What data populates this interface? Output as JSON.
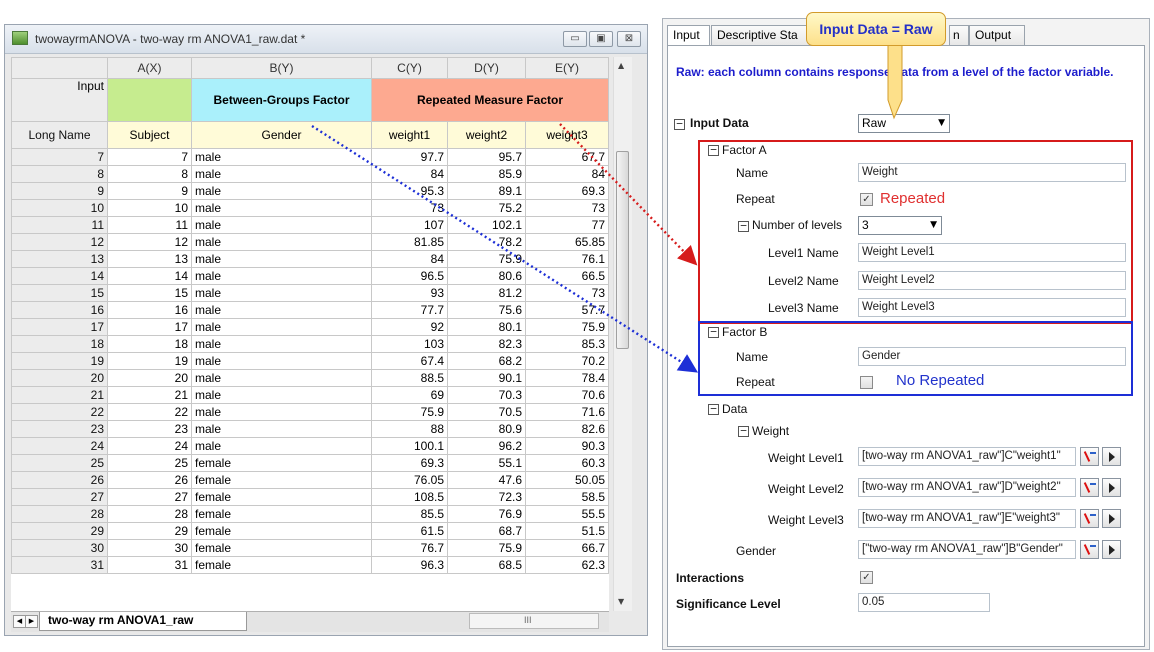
{
  "worksheet": {
    "title": "twowayrmANOVA - two-way rm ANOVA1_raw.dat *",
    "window_buttons": [
      "▭",
      "▣",
      "⊠"
    ],
    "col_headers": [
      "",
      "A(X)",
      "B(Y)",
      "C(Y)",
      "D(Y)",
      "E(Y)"
    ],
    "input_row": {
      "label": "Input",
      "between": "Between-Groups Factor",
      "repeated": "Repeated Measure Factor"
    },
    "longname_row": {
      "label": "Long Name",
      "cells": [
        "Subject",
        "Gender",
        "weight1",
        "weight2",
        "weight3"
      ]
    },
    "rows": [
      [
        "7",
        "7",
        "male",
        "97.7",
        "95.7",
        "67.7"
      ],
      [
        "8",
        "8",
        "male",
        "84",
        "85.9",
        "84"
      ],
      [
        "9",
        "9",
        "male",
        "95.3",
        "89.1",
        "69.3"
      ],
      [
        "10",
        "10",
        "male",
        "73",
        "75.2",
        "73"
      ],
      [
        "11",
        "11",
        "male",
        "107",
        "102.1",
        "77"
      ],
      [
        "12",
        "12",
        "male",
        "81.85",
        "78.2",
        "65.85"
      ],
      [
        "13",
        "13",
        "male",
        "84",
        "75.9",
        "76.1"
      ],
      [
        "14",
        "14",
        "male",
        "96.5",
        "80.6",
        "66.5"
      ],
      [
        "15",
        "15",
        "male",
        "93",
        "81.2",
        "73"
      ],
      [
        "16",
        "16",
        "male",
        "77.7",
        "75.6",
        "57.7"
      ],
      [
        "17",
        "17",
        "male",
        "92",
        "80.1",
        "75.9"
      ],
      [
        "18",
        "18",
        "male",
        "103",
        "82.3",
        "85.3"
      ],
      [
        "19",
        "19",
        "male",
        "67.4",
        "68.2",
        "70.2"
      ],
      [
        "20",
        "20",
        "male",
        "88.5",
        "90.1",
        "78.4"
      ],
      [
        "21",
        "21",
        "male",
        "69",
        "70.3",
        "70.6"
      ],
      [
        "22",
        "22",
        "male",
        "75.9",
        "70.5",
        "71.6"
      ],
      [
        "23",
        "23",
        "male",
        "88",
        "80.9",
        "82.6"
      ],
      [
        "24",
        "24",
        "male",
        "100.1",
        "96.2",
        "90.3"
      ],
      [
        "25",
        "25",
        "female",
        "69.3",
        "55.1",
        "60.3"
      ],
      [
        "26",
        "26",
        "female",
        "76.05",
        "47.6",
        "50.05"
      ],
      [
        "27",
        "27",
        "female",
        "108.5",
        "72.3",
        "58.5"
      ],
      [
        "28",
        "28",
        "female",
        "85.5",
        "76.9",
        "55.5"
      ],
      [
        "29",
        "29",
        "female",
        "61.5",
        "68.7",
        "51.5"
      ],
      [
        "30",
        "30",
        "female",
        "76.7",
        "75.9",
        "66.7"
      ],
      [
        "31",
        "31",
        "female",
        "96.3",
        "68.5",
        "62.3"
      ]
    ],
    "sheet_tab": "two-way rm ANOVA1_raw",
    "hscroll_label": "III"
  },
  "dialog": {
    "tabs": [
      "Input",
      "Descriptive Sta",
      "n",
      "Output"
    ],
    "callout": "Input Data = Raw",
    "description": "Raw: each column contains response data from a level of the factor variable.",
    "input_data_label": "Input Data",
    "input_data_value": "Raw",
    "factor_a": {
      "label": "Factor A",
      "name_label": "Name",
      "name_value": "Weight",
      "repeat_label": "Repeat",
      "repeat_note": "Repeated",
      "levels_label": "Number of levels",
      "levels_value": "3",
      "level_names": [
        {
          "label": "Level1 Name",
          "value": "Weight Level1"
        },
        {
          "label": "Level2 Name",
          "value": "Weight Level2"
        },
        {
          "label": "Level3 Name",
          "value": "Weight Level3"
        }
      ]
    },
    "factor_b": {
      "label": "Factor B",
      "name_label": "Name",
      "name_value": "Gender",
      "repeat_label": "Repeat",
      "repeat_note": "No Repeated"
    },
    "data": {
      "label": "Data",
      "weight_label": "Weight",
      "ranges": [
        {
          "label": "Weight Level1",
          "value": "[two-way rm ANOVA1_raw\"]C\"weight1\""
        },
        {
          "label": "Weight Level2",
          "value": "[two-way rm ANOVA1_raw\"]D\"weight2\""
        },
        {
          "label": "Weight Level3",
          "value": "[two-way rm ANOVA1_raw\"]E\"weight3\""
        }
      ],
      "gender_label": "Gender",
      "gender_value": "[\"two-way rm ANOVA1_raw\"]B\"Gender\""
    },
    "interactions_label": "Interactions",
    "significance_label": "Significance Level",
    "significance_value": "0.05"
  },
  "colors": {
    "red_box": "#d61b1b",
    "blue_box": "#1d2fd6",
    "callout_fill": "#fde08a"
  }
}
